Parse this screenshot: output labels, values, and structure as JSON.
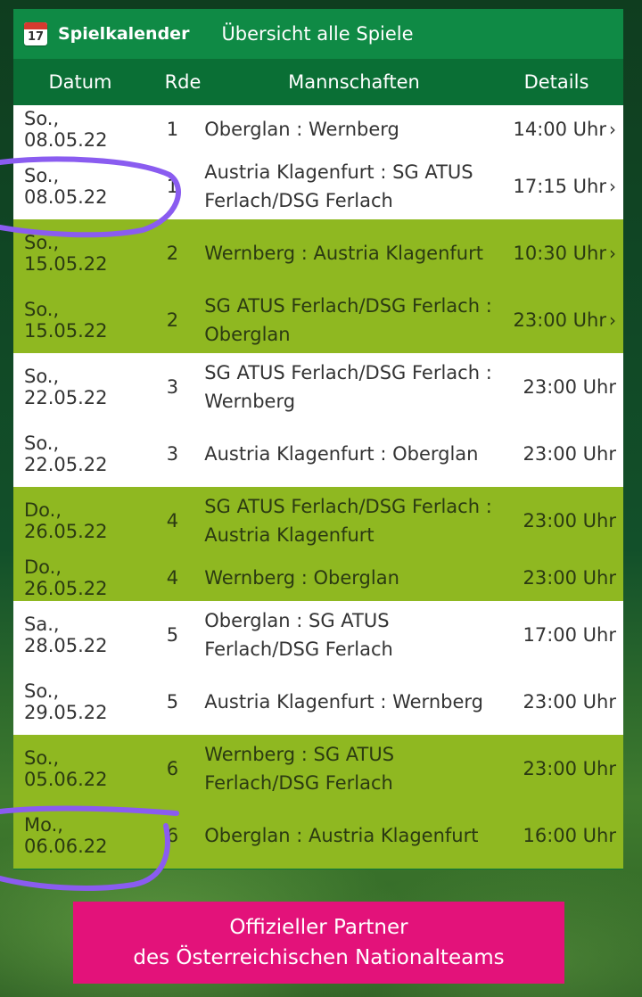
{
  "header": {
    "calendar_icon_day": "17",
    "brand_label": "Spielkalender",
    "overview_link": "Übersicht alle Spiele"
  },
  "columns": {
    "date": "Datum",
    "round": "Rde",
    "teams": "Mannschaften",
    "details": "Details"
  },
  "colors": {
    "header_green": "#0f8a45",
    "column_header_green": "#0a6f35",
    "row_white": "#ffffff",
    "row_lime": "#8fb821",
    "partner_pink": "#e3127a",
    "annotation_purple": "#8a5cf0"
  },
  "matches": [
    {
      "date": "So., 08.05.22",
      "round": "1",
      "teams": "Oberglan : Wernberg",
      "time": "14:00 Uhr",
      "has_chevron": true,
      "style": "white"
    },
    {
      "date": "So., 08.05.22",
      "round": "1",
      "teams": "Austria Klagenfurt : SG ATUS Ferlach/DSG Ferlach",
      "time": "17:15 Uhr",
      "has_chevron": true,
      "style": "white"
    },
    {
      "date": "So., 15.05.22",
      "round": "2",
      "teams": "Wernberg : Austria Klagenfurt",
      "time": "10:30 Uhr",
      "has_chevron": true,
      "style": "lime"
    },
    {
      "date": "So., 15.05.22",
      "round": "2",
      "teams": "SG ATUS Ferlach/DSG Ferlach : Oberglan",
      "time": "23:00 Uhr",
      "has_chevron": true,
      "style": "lime"
    },
    {
      "date": "So., 22.05.22",
      "round": "3",
      "teams": "SG ATUS Ferlach/DSG Ferlach : Wernberg",
      "time": "23:00 Uhr",
      "has_chevron": false,
      "style": "white"
    },
    {
      "date": "So., 22.05.22",
      "round": "3",
      "teams": "Austria Klagenfurt : Oberglan",
      "time": "23:00 Uhr",
      "has_chevron": false,
      "style": "white"
    },
    {
      "date": "Do., 26.05.22",
      "round": "4",
      "teams": "SG ATUS Ferlach/DSG Ferlach : Austria Klagenfurt",
      "time": "23:00 Uhr",
      "has_chevron": false,
      "style": "lime"
    },
    {
      "date": "Do., 26.05.22",
      "round": "4",
      "teams": "Wernberg : Oberglan",
      "time": "23:00 Uhr",
      "has_chevron": false,
      "style": "lime"
    },
    {
      "date": "Sa., 28.05.22",
      "round": "5",
      "teams": "Oberglan : SG ATUS Ferlach/DSG Ferlach",
      "time": "17:00 Uhr",
      "has_chevron": false,
      "style": "white"
    },
    {
      "date": "So., 29.05.22",
      "round": "5",
      "teams": "Austria Klagenfurt : Wernberg",
      "time": "23:00 Uhr",
      "has_chevron": false,
      "style": "white"
    },
    {
      "date": "So., 05.06.22",
      "round": "6",
      "teams": "Wernberg : SG ATUS Ferlach/DSG Ferlach",
      "time": "23:00 Uhr",
      "has_chevron": false,
      "style": "lime"
    },
    {
      "date": "Mo., 06.06.22",
      "round": "6",
      "teams": "Oberglan : Austria Klagenfurt",
      "time": "16:00 Uhr",
      "has_chevron": false,
      "style": "lime"
    }
  ],
  "partner": {
    "line1": "Offizieller Partner",
    "line2": "des Österreichischen Nationalteams"
  }
}
